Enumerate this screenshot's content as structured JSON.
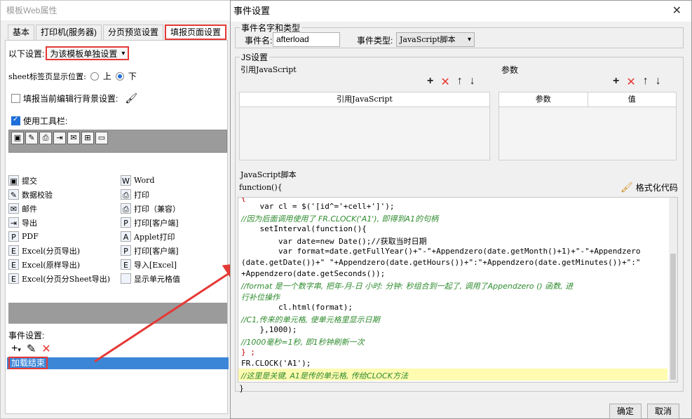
{
  "left": {
    "title": "模板Web属性",
    "tabs": [
      "基本",
      "打印机(服务器)",
      "分页预览设置",
      "填报页面设置"
    ],
    "setting_label": "以下设置:",
    "setting_value": "为该模板单独设置",
    "sheet_pos_label": "sheet标签页显示位置:",
    "radio_up": "上",
    "radio_down": "下",
    "fill_bg_label": "填报当前编辑行背景设置:",
    "use_toolbar_label": "使用工具栏:",
    "tools": [
      {
        "icon": "submit-icon",
        "glyph": "▣",
        "label": "提交"
      },
      {
        "icon": "word-icon",
        "glyph": "W",
        "label": "Word"
      },
      {
        "icon": "validate-icon",
        "glyph": "✎",
        "label": "数据校验"
      },
      {
        "icon": "print-icon",
        "glyph": "⎙",
        "label": "打印"
      },
      {
        "icon": "mail-icon",
        "glyph": "✉",
        "label": "邮件"
      },
      {
        "icon": "print-compat-icon",
        "glyph": "⎙",
        "label": "打印（兼容）"
      },
      {
        "icon": "export-icon",
        "glyph": "⇥",
        "label": "导出"
      },
      {
        "icon": "print-client-icon",
        "glyph": "P",
        "label": "打印[客户端]"
      },
      {
        "icon": "pdf-icon",
        "glyph": "P",
        "label": "PDF"
      },
      {
        "icon": "applet-print-icon",
        "glyph": "A",
        "label": "Applet打印"
      },
      {
        "icon": "excel-page-icon",
        "glyph": "E",
        "label": "Excel(分页导出)"
      },
      {
        "icon": "print-client2-icon",
        "glyph": "P",
        "label": "打印[客户端]"
      },
      {
        "icon": "excel-orig-icon",
        "glyph": "E",
        "label": "Excel(原样导出)"
      },
      {
        "icon": "import-excel-icon",
        "glyph": "E",
        "label": "导入[Excel]"
      },
      {
        "icon": "excel-sheet-icon",
        "glyph": "E",
        "label": "Excel(分页分Sheet导出)"
      },
      {
        "icon": "show-cell-icon",
        "glyph": " ",
        "label": "显示单元格值"
      }
    ],
    "event_label": "事件设置:",
    "event_item": "加载结束"
  },
  "dialog": {
    "title": "事件设置",
    "event_group": "事件名字和类型",
    "event_name_label": "事件名:",
    "event_name_value": "afterload",
    "event_type_label": "事件类型:",
    "event_type_value": "JavaScript脚本",
    "js_group": "JS设置",
    "ref_js_label": "引用JavaScript",
    "params_label": "参数",
    "ref_js_col": "引用JavaScript",
    "param_col": "参数",
    "value_col": "值",
    "script_label": "JavaScript脚本",
    "function_open": "function(){",
    "format_code": "格式化代码",
    "function_close": "}",
    "code_lines": [
      "{",
      "    var cl = $('[id^='+cell+']');",
      "//因为后面调用使用了 FR.CLOCK('A1'), 即得到A1的句柄",
      "    setInterval(function(){",
      "        var date=new Date();//获取当时日期",
      "        var format=date.getFullYear()+\"-\"+Appendzero(date.getMonth()+1)+\"-\"+Appendzero",
      "(date.getDate())+\" \"+Appendzero(date.getHours())+\":\"+Appendzero(date.getMinutes())+\":\"",
      "+Appendzero(date.getSeconds());",
      "//format 是一个数字串, 把年-月-日 小时: 分钟: 秒组合到一起了, 调用了Appendzero () 函数, 进",
      "行补位操作",
      "        cl.html(format);",
      "//C1,传来的单元格, 使单元格里显示日期",
      "    },1000);",
      "//1000毫秒=1秒, 即1秒钟刷新一次",
      "} ;",
      "FR.CLOCK('A1');",
      "//这里是关键, A1是传的单元格, 传给CLOCK方法"
    ],
    "ok_label": "确定",
    "cancel_label": "取消"
  },
  "colors": {
    "accent_red": "#e53935",
    "selection_blue": "#3c86d8",
    "comment_green": "#2e8b2e",
    "highlight_yellow": "#fffbb0"
  }
}
